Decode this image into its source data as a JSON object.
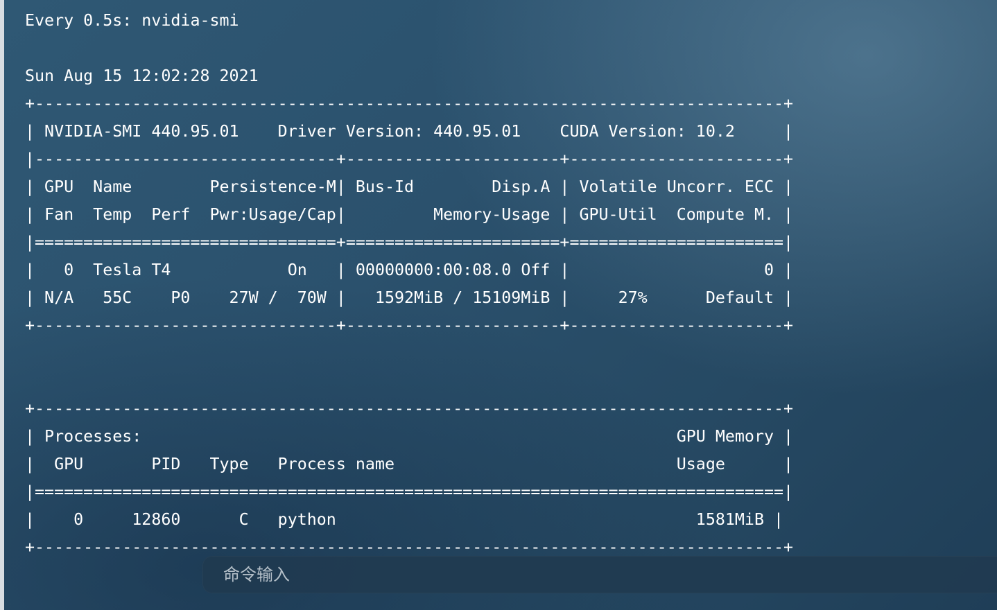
{
  "terminal": {
    "header": "Every 0.5s: nvidia-smi",
    "blank1": "",
    "timestamp": "Sun Aug 15 12:02:28 2021",
    "border_top": "+-----------------------------------------------------------------------------+",
    "version_row": "| NVIDIA-SMI 440.95.01    Driver Version: 440.95.01    CUDA Version: 10.2     |",
    "gpu_sep": "|-------------------------------+----------------------+----------------------+",
    "gpu_header_1": "| GPU  Name        Persistence-M| Bus-Id        Disp.A | Volatile Uncorr. ECC |",
    "gpu_header_2": "| Fan  Temp  Perf  Pwr:Usage/Cap|         Memory-Usage | GPU-Util  Compute M. |",
    "gpu_double_sep": "|===============================+======================+======================|",
    "gpu_row_1": "|   0  Tesla T4            On   | 00000000:00:08.0 Off |                    0 |",
    "gpu_row_2": "| N/A   55C    P0    27W /  70W |   1592MiB / 15109MiB |     27%      Default |",
    "gpu_border_bottom": "+-------------------------------+----------------------+----------------------+",
    "blank2": "",
    "blank3": "",
    "proc_border_top": "+-----------------------------------------------------------------------------+",
    "proc_header_1": "| Processes:                                                       GPU Memory |",
    "proc_header_2": "|  GPU       PID   Type   Process name                             Usage      |",
    "proc_double_sep": "|=============================================================================|",
    "proc_row_1": "|    0     12860      C   python                                     1581MiB |",
    "proc_border_bottom": "+-----------------------------------------------------------------------------+"
  },
  "command_bar": {
    "placeholder": "命令输入"
  }
}
